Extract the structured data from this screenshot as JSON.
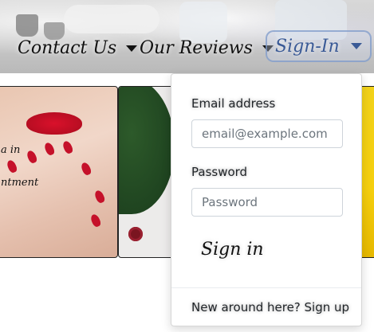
{
  "nav": {
    "items": [
      {
        "label": "Contact Us"
      },
      {
        "label": "Our Reviews"
      },
      {
        "label": "Sign-In"
      }
    ]
  },
  "gallery": {
    "card1_text_top": "a in",
    "card1_text_bottom": "ntment"
  },
  "signin_menu": {
    "email_label": "Email address",
    "email_placeholder": "email@example.com",
    "email_value": "",
    "password_label": "Password",
    "password_placeholder": "Password",
    "password_value": "",
    "submit_label": "Sign in",
    "footer_link": "New around here? Sign up"
  },
  "colors": {
    "signin_accent": "#3a5a96",
    "nail_polish": "#c5112a"
  }
}
